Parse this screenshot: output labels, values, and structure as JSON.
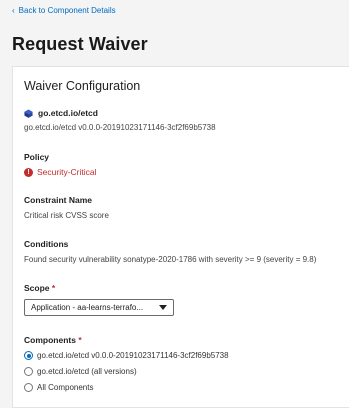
{
  "back_link": {
    "label": "Back to Component Details",
    "icon": "chevron-left-icon"
  },
  "page": {
    "title": "Request Waiver"
  },
  "card": {
    "title": "Waiver Configuration",
    "component": {
      "name": "go.etcd.io/etcd",
      "version": "go.etcd.io/etcd v0.0.0-20191023171146-3cf2f69b5738",
      "icon": "cube-icon",
      "icon_color": "#1b3a8a"
    },
    "policy": {
      "label": "Policy",
      "value": "Security-Critical",
      "color": "#c22c2c"
    },
    "constraint": {
      "label": "Constraint Name",
      "value": "Critical risk CVSS score"
    },
    "conditions": {
      "label": "Conditions",
      "value": "Found security vulnerability sonatype-2020-1786 with severity >= 9 (severity = 9.8)"
    },
    "scope": {
      "label": "Scope",
      "required_mark": "*",
      "selected": "Application - aa-learns-terrafo..."
    },
    "components": {
      "label": "Components",
      "required_mark": "*",
      "options": [
        {
          "label": "go.etcd.io/etcd v0.0.0-20191023171146-3cf2f69b5738",
          "checked": true
        },
        {
          "label": "go.etcd.io/etcd (all versions)",
          "checked": false
        },
        {
          "label": "All Components",
          "checked": false
        }
      ]
    }
  },
  "colors": {
    "accent": "#006bbf",
    "critical": "#c22c2c",
    "background": "#f4f4f4"
  }
}
